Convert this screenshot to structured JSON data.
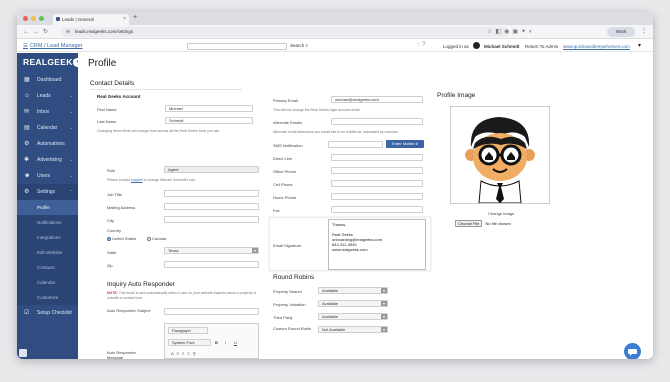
{
  "browser": {
    "tab_title": "Leads | General",
    "url": "leads.realgeeks.com/settings",
    "work_label": "Work"
  },
  "app": {
    "crm_label": "CRM / Lead Manager",
    "search_label": "Search",
    "logged_in_prefix": "Logged in as",
    "user_name": "Michael Schmidt",
    "return_admin": "Return To Admin",
    "site_link": "www.quicksandtempehomes.com"
  },
  "sidebar": {
    "brand": "REALGEEKS",
    "items": [
      {
        "label": "Dashboard",
        "icon": "dashboard-icon"
      },
      {
        "label": "Leads",
        "icon": "leads-icon"
      },
      {
        "label": "Inbox",
        "icon": "inbox-icon"
      },
      {
        "label": "Calendar",
        "icon": "calendar-icon"
      },
      {
        "label": "Automations",
        "icon": "automations-icon"
      },
      {
        "label": "Advertising",
        "icon": "advertising-icon"
      },
      {
        "label": "Users",
        "icon": "users-icon"
      },
      {
        "label": "Settings",
        "icon": "settings-icon"
      }
    ],
    "settings_sub": [
      "Profile",
      "Notifications",
      "Integrations",
      "Edit Website",
      "Contacts",
      "Calendar",
      "Customize"
    ],
    "setup_checklist": "Setup Checklist"
  },
  "page": {
    "title": "Profile",
    "contact_details": "Contact Details",
    "account_title": "Real Geeks Account",
    "first_name_label": "First Name",
    "first_name": "Michael",
    "last_name_label": "Last Name",
    "last_name": "Schmidt",
    "name_note": "Changing these fields will change from across all the Real Geeks tools you use.",
    "role_label": "Role",
    "role_value": "Agent",
    "role_note_pre": "Please contact",
    "role_note_link": "support",
    "role_note_post": "to change Michael Schmidt's role.",
    "job_title_label": "Job Title",
    "mailing_address_label": "Mailing Address",
    "city_label": "City",
    "country_label": "Country",
    "country_us": "United States",
    "country_ca": "Canada",
    "state_label": "State",
    "state_value": "Texas",
    "zip_label": "Zip",
    "primary_email_label": "Primary Email",
    "primary_email": "michael@realgeeks.com",
    "primary_email_note": "This will not change the Real Geeks login account email.",
    "alt_emails_label": "Alternate Emails",
    "alt_emails_note": "Alternate email addresses you would like to be notified at, separated by commas.",
    "sms_label": "SMS Notification",
    "sms_button": "Enter Mobile #",
    "direct_line_label": "Direct Line",
    "office_phone_label": "Office Phone",
    "cell_phone_label": "Cell Phone",
    "home_phone_label": "Home Phone",
    "fax_label": "Fax",
    "email_signature_label": "Email Signature",
    "email_signature": "Thanks,\n\nReal Geeks\nonboarding@realgeeks.com\n844-311-4949\nwww.realgeeks.com",
    "round_robins": "Round Robins",
    "rr_rows": [
      {
        "label": "Property Search",
        "value": "Available"
      },
      {
        "label": "Property Valuation",
        "value": "Available"
      },
      {
        "label": "Third Party",
        "value": "Available"
      },
      {
        "label": "Custom Round Robin",
        "value": "Not Available"
      }
    ],
    "profile_image": "Profile Image",
    "change_image": "Change Image",
    "choose_file": "Choose File",
    "no_file": "No file chosen",
    "inquiry_title": "Inquiry Auto Responder",
    "inquiry_note_label": "NOTE:",
    "inquiry_note": "This email is sent automatically when a user on your website inquires about a property or submits a contact form.",
    "ar_subject_label": "Auto Responder Subject",
    "ar_message_label": "Auto Responder Message",
    "editor_format": "Paragraph",
    "editor_font": "System Font"
  }
}
